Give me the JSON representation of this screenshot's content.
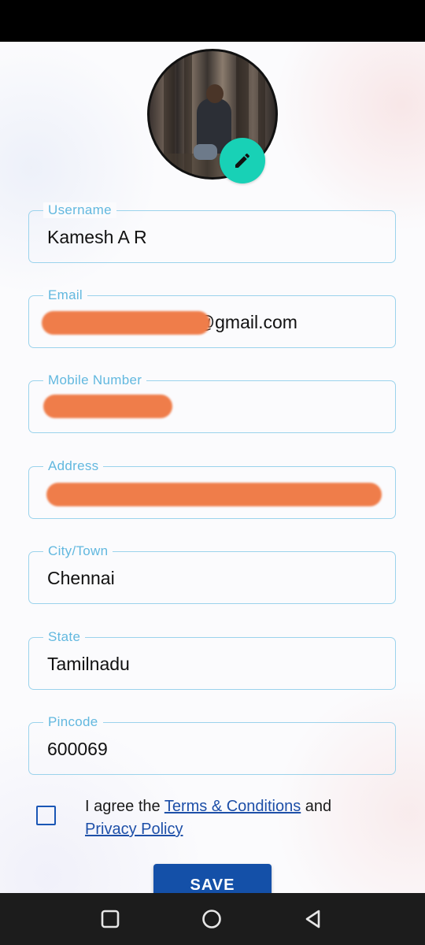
{
  "profile": {
    "edit_icon": "pencil-icon"
  },
  "form": {
    "fields": [
      {
        "label": "Username",
        "value": "Kamesh A R"
      },
      {
        "label": "Email",
        "value": "a@gmail.com"
      },
      {
        "label": "Mobile Number",
        "value": ""
      },
      {
        "label": "Address",
        "value": ""
      },
      {
        "label": "City/Town",
        "value": "Chennai"
      },
      {
        "label": "State",
        "value": "Tamilnadu"
      },
      {
        "label": "Pincode",
        "value": "600069"
      }
    ]
  },
  "agreement": {
    "prefix": "I agree the ",
    "terms_link": "Terms & Conditions",
    "middle": " and",
    "privacy_link": "Privacy Policy",
    "checked": false
  },
  "actions": {
    "save_label": "SAVE"
  },
  "colors": {
    "accent": "#18d1b6",
    "field_border": "#9bd3ec",
    "label": "#62b8df",
    "primary_button": "#1450a8",
    "redaction": "#ef7d4a"
  },
  "nav": {
    "recents_icon": "square-icon",
    "home_icon": "circle-icon",
    "back_icon": "triangle-back-icon"
  }
}
